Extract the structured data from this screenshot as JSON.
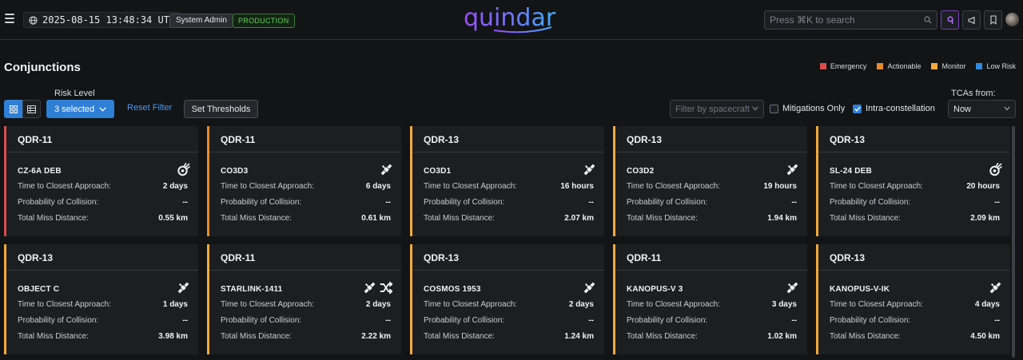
{
  "header": {
    "timestamp": "2025-08-15 13:48:34 UTC",
    "role": "System Admin",
    "environment": "PRODUCTION",
    "logo_text": "quindar",
    "search_placeholder": "Press ⌘K to search",
    "icons": [
      "menu-icon",
      "globe-icon",
      "search-icon",
      "ai-assistant-icon",
      "announcement-icon",
      "bookmark-icon",
      "avatar"
    ]
  },
  "page": {
    "title": "Conjunctions",
    "legend": [
      {
        "label": "Emergency",
        "color": "#db4d4d"
      },
      {
        "label": "Actionable",
        "color": "#e68a2e"
      },
      {
        "label": "Monitor",
        "color": "#f2a93b"
      },
      {
        "label": "Low Risk",
        "color": "#2f8be0"
      }
    ]
  },
  "filters": {
    "risk_level_label": "Risk Level",
    "risk_level_value": "3 selected",
    "reset_label": "Reset Filter",
    "thresholds_label": "Set Thresholds",
    "spacecraft_placeholder": "Filter by spacecraft",
    "mitigations_only_label": "Mitigations Only",
    "mitigations_only_checked": false,
    "intra_constellation_label": "Intra-constellation",
    "intra_constellation_checked": true,
    "tcas_from_label": "TCAs from:",
    "tcas_from_value": "Now"
  },
  "labels": {
    "tca": "Time to Closest Approach:",
    "poc": "Probability of Collision:",
    "miss": "Total Miss Distance:"
  },
  "cards": [
    {
      "spacecraft": "QDR-11",
      "object": "CZ-6A DEB",
      "icons": [
        "debris-icon"
      ],
      "tca": "2 days",
      "poc": "--",
      "miss": "0.55 km",
      "risk": "emergency"
    },
    {
      "spacecraft": "QDR-11",
      "object": "CO3D3",
      "icons": [
        "satellite-icon"
      ],
      "tca": "6 days",
      "poc": "--",
      "miss": "0.61 km",
      "risk": "actionable"
    },
    {
      "spacecraft": "QDR-13",
      "object": "CO3D1",
      "icons": [
        "satellite-icon"
      ],
      "tca": "16 hours",
      "poc": "--",
      "miss": "2.07 km",
      "risk": "monitor"
    },
    {
      "spacecraft": "QDR-13",
      "object": "CO3D2",
      "icons": [
        "satellite-icon"
      ],
      "tca": "19 hours",
      "poc": "--",
      "miss": "1.94 km",
      "risk": "monitor"
    },
    {
      "spacecraft": "QDR-13",
      "object": "SL-24 DEB",
      "icons": [
        "debris-icon"
      ],
      "tca": "20 hours",
      "poc": "--",
      "miss": "2.09 km",
      "risk": "monitor"
    },
    {
      "spacecraft": "QDR-13",
      "object": "OBJECT C",
      "icons": [
        "satellite-icon"
      ],
      "tca": "1 days",
      "poc": "--",
      "miss": "3.98 km",
      "risk": "monitor"
    },
    {
      "spacecraft": "QDR-11",
      "object": "STARLINK-1411",
      "icons": [
        "satellite-icon",
        "maneuver-icon"
      ],
      "tca": "2 days",
      "poc": "--",
      "miss": "2.22 km",
      "risk": "monitor"
    },
    {
      "spacecraft": "QDR-13",
      "object": "COSMOS 1953",
      "icons": [
        "satellite-icon"
      ],
      "tca": "2 days",
      "poc": "--",
      "miss": "1.24 km",
      "risk": "monitor"
    },
    {
      "spacecraft": "QDR-11",
      "object": "KANOPUS-V 3",
      "icons": [
        "satellite-icon"
      ],
      "tca": "3 days",
      "poc": "--",
      "miss": "1.02 km",
      "risk": "monitor"
    },
    {
      "spacecraft": "QDR-13",
      "object": "KANOPUS-V-IK",
      "icons": [
        "satellite-icon"
      ],
      "tca": "4 days",
      "poc": "--",
      "miss": "4.50 km",
      "risk": "monitor"
    }
  ]
}
